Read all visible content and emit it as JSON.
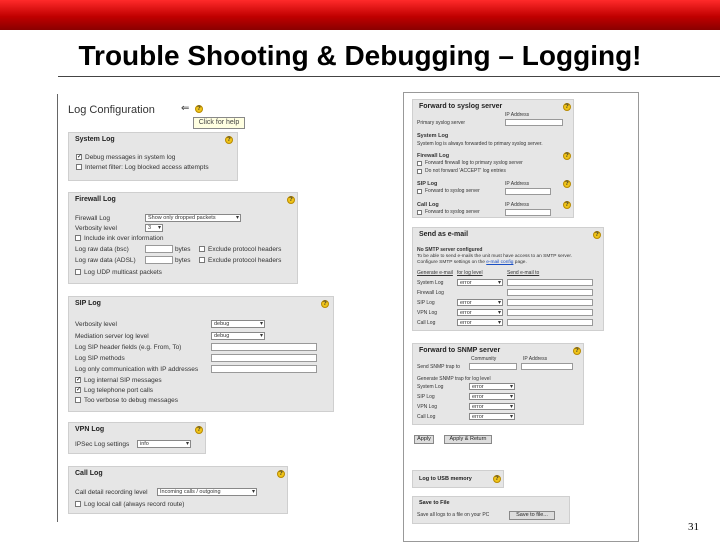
{
  "slide": {
    "title": "Trouble Shooting & Debugging – Logging!",
    "page_number": "31"
  },
  "left": {
    "header": "Log Configuration",
    "tooltip": "Click for help",
    "system_log": {
      "title": "System Log",
      "debug": "Debug messages in system log",
      "internet_filter": "Internet filter: Log blocked access attempts"
    },
    "firewall_log": {
      "title": "Firewall Log",
      "firewall_log_label": "Firewall Log",
      "firewall_log_value": "Show only dropped packets",
      "verbosity_label": "Verbosity level",
      "verbosity_value": "3",
      "include_ink": "Include ink over information",
      "raw_bsc": "Log raw data (bsc)",
      "raw_adsl": "Log raw data (ADSL)",
      "bytes": "bytes",
      "exclude": "Exclude protocol headers",
      "udp": "Log UDP multicast packets"
    },
    "sip_log": {
      "title": "SIP Log",
      "verbosity_label": "Verbosity level",
      "verbosity_value": "debug",
      "mediation_label": "Mediation server log level",
      "mediation_value": "debug",
      "header": "Log SIP header fields (e.g. From, To)",
      "methods": "Log SIP methods",
      "only_ip": "Log only communication with IP addresses",
      "internal": "Log internal SIP messages",
      "telephone": "Log telephone port calls",
      "too_verbose": "Too verbose to debug messages"
    },
    "vpn_log": {
      "title": "VPN Log",
      "ipsec_label": "IPSec Log settings",
      "ipsec_value": "info"
    },
    "call_log": {
      "title": "Call Log",
      "detail_label": "Call detail recording level",
      "detail_value": "Incoming calls / outgoing",
      "local": "Log local call (always record route)"
    }
  },
  "right": {
    "forward_syslog": {
      "title": "Forward to syslog server",
      "primary": "Primary syslog server",
      "ip": "IP Address",
      "system_log": "System Log",
      "system_desc": "System log is always forwarded to primary syslog server.",
      "firewall_log": "Firewall Log",
      "fw_forward": "Forward firewall log to primary syslog server",
      "fw_no": "Do not forward 'ACCEPT' log entries",
      "sip_log": "SIP Log",
      "sip_forward": "Forward to syslog server",
      "call_log": "Call Log",
      "call_forward": "Forward to syslog server"
    },
    "send_email": {
      "title": "Send as e-mail",
      "no_smtp": "No SMTP server configured",
      "desc1": "To be able to send e-mails the unit must have access to an SMTP server.",
      "desc2_pre": "Configure SMTP settings on the ",
      "desc2_link": "e-mail config",
      "desc2_post": " page.",
      "col_generate": "Generate e-mail",
      "col_level": "for log level",
      "col_send": "Send e-mail to",
      "rows": [
        {
          "label": "System Log",
          "level": "error"
        },
        {
          "label": "Firewall Log",
          "level": ""
        },
        {
          "label": "SIP Log",
          "level": "error"
        },
        {
          "label": "VPN Log",
          "level": "error"
        },
        {
          "label": "Call Log",
          "level": "error"
        }
      ]
    },
    "forward_snmp": {
      "title": "Forward to SNMP server",
      "community": "Community",
      "ip": "IP Address",
      "send_snmp": "Send SNMP trap to",
      "generate": "Generate SNMP trap for log level",
      "rows": [
        {
          "label": "System Log",
          "level": "error"
        },
        {
          "label": "SIP Log",
          "level": "error"
        },
        {
          "label": "VPN Log",
          "level": "error"
        },
        {
          "label": "Call Log",
          "level": "error"
        }
      ]
    },
    "apply": "Apply",
    "apply_return": "Apply & Return",
    "usb": {
      "title": "Log to USB memory"
    },
    "save_file": {
      "title": "Save to File",
      "desc": "Save all logs to a file on your PC",
      "button": "Save to file..."
    }
  }
}
